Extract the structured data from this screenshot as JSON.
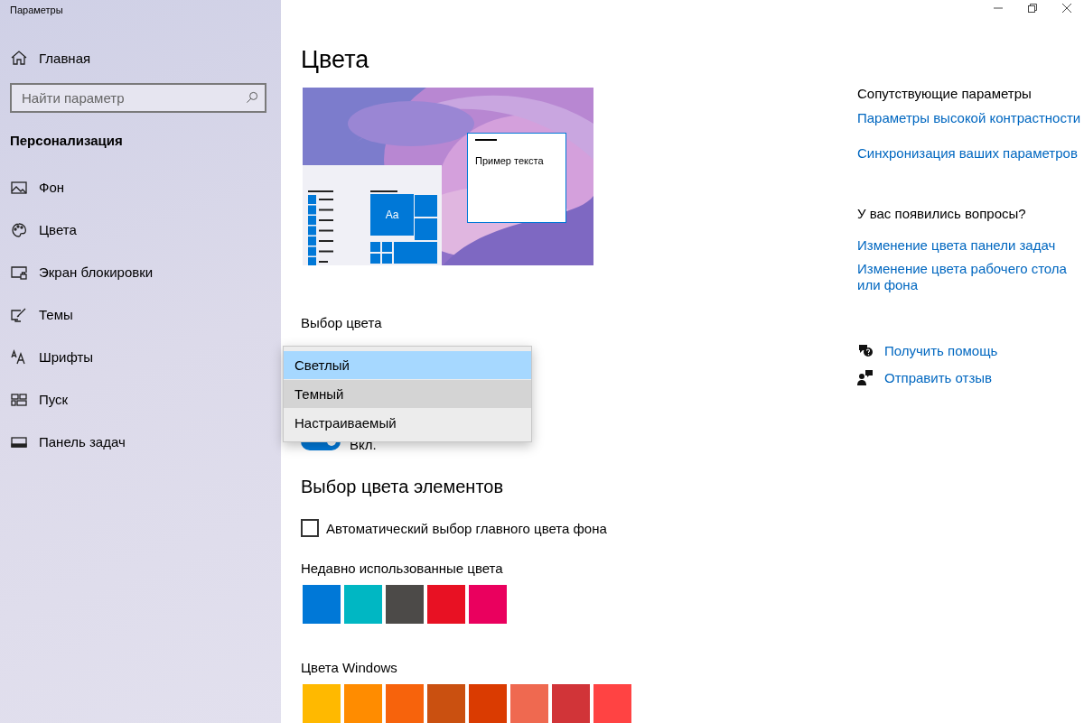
{
  "window": {
    "title": "Параметры",
    "controls": [
      {
        "kind": "minimize"
      },
      {
        "kind": "restore"
      },
      {
        "kind": "close"
      }
    ]
  },
  "sidebar": {
    "home": "Главная",
    "search": {
      "placeholder": "Найти параметр"
    },
    "section": "Персонализация",
    "items": [
      {
        "label": "Фон"
      },
      {
        "label": "Цвета"
      },
      {
        "label": "Экран блокировки"
      },
      {
        "label": "Темы"
      },
      {
        "label": "Шрифты"
      },
      {
        "label": "Пуск"
      },
      {
        "label": "Панель задач"
      }
    ]
  },
  "main": {
    "title": "Цвета",
    "preview": {
      "tile_text": "Aa",
      "sample_text": "Пример текста"
    },
    "color_choice": {
      "label": "Выбор цвета",
      "options": [
        {
          "label": "Светлый",
          "selected": true,
          "hovered": false
        },
        {
          "label": "Темный",
          "selected": false,
          "hovered": true
        },
        {
          "label": "Настраиваемый",
          "selected": false,
          "hovered": false
        }
      ]
    },
    "toggle": {
      "label": "Вкл.",
      "on": true
    },
    "accent": {
      "title": "Выбор цвета элементов",
      "auto_checkbox": {
        "label": "Автоматический выбор главного цвета фона",
        "checked": false
      },
      "recent_label": "Недавно использованные цвета",
      "recent": [
        {
          "color": "#0078d7"
        },
        {
          "color": "#00b7c3"
        },
        {
          "color": "#4c4a48"
        },
        {
          "color": "#e81123"
        },
        {
          "color": "#ea005e"
        }
      ],
      "windows_label": "Цвета Windows",
      "windows": [
        {
          "color": "#ffb900"
        },
        {
          "color": "#ff8c00"
        },
        {
          "color": "#f7630c"
        },
        {
          "color": "#ca5010"
        },
        {
          "color": "#da3b01"
        },
        {
          "color": "#ef6950"
        },
        {
          "color": "#d13438"
        },
        {
          "color": "#ff4343"
        }
      ]
    }
  },
  "related": {
    "title": "Сопутствующие параметры",
    "links": [
      "Параметры высокой контрастности",
      "Синхронизация ваших параметров"
    ]
  },
  "questions": {
    "title": "У вас появились вопросы?",
    "links": [
      "Изменение цвета панели задач",
      "Изменение цвета рабочего стола или фона"
    ]
  },
  "help": [
    {
      "kind": "help",
      "label": "Получить помощь"
    },
    {
      "kind": "feedback",
      "label": "Отправить отзыв"
    }
  ]
}
